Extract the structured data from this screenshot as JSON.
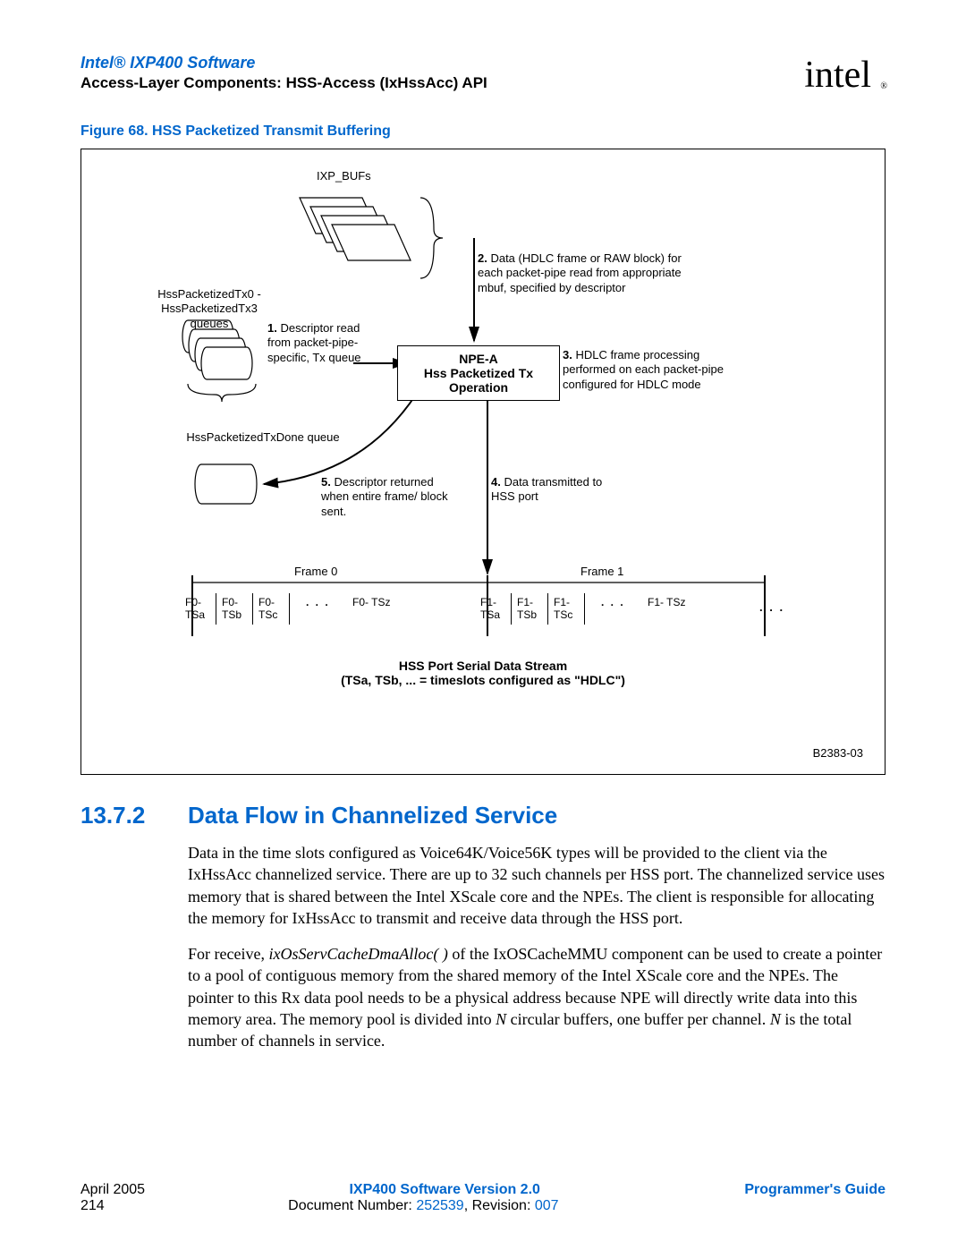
{
  "header": {
    "title": "Intel® IXP400 Software",
    "subtitle": "Access-Layer Components: HSS-Access (IxHssAcc) API",
    "logo_text": "intel",
    "logo_reg": "®"
  },
  "figure": {
    "caption": "Figure 68. HSS Packetized Transmit Buffering",
    "ixpbufs": "IXP_BUFs",
    "queues_label": "HssPacketizedTx0 - HssPacketizedTx3 queues",
    "step1_num": "1.",
    "step1": " Descriptor read from packet-pipe-specific, Tx queue",
    "npe_line1": "NPE-A",
    "npe_line2": "Hss Packetized Tx",
    "npe_line3": "Operation",
    "step2_num": "2.",
    "step2": " Data (HDLC frame or RAW block) for each packet-pipe read from appropriate mbuf, specified by descriptor",
    "step3_num": "3.",
    "step3": " HDLC frame processing performed on each packet-pipe configured for HDLC mode",
    "txdone": "HssPacketizedTxDone queue",
    "step5_num": "5.",
    "step5": " Descriptor returned when entire frame/ block sent.",
    "step4_num": "4.",
    "step4": " Data transmitted to HSS port",
    "frame0": "Frame 0",
    "frame1": "Frame 1",
    "dots": ". . .",
    "ts": {
      "f0a": "F0-\nTSa",
      "f0b": "F0-\nTSb",
      "f0c": "F0-\nTSc",
      "f0z": "F0-\nTSz",
      "f1a": "F1-\nTSa",
      "f1b": "F1-\nTSb",
      "f1c": "F1-\nTSc",
      "f1z": "F1-\nTSz"
    },
    "stream1": "HSS Port Serial Data Stream",
    "stream2": "(TSa, TSb, ... = timeslots configured as \"HDLC\")",
    "figid": "B2383-03"
  },
  "section": {
    "num": "13.7.2",
    "title": "Data Flow in Channelized Service"
  },
  "para1_a": "Data in the time slots configured as Voice64K/Voice56K types will be provided to the client via the IxHssAcc channelized service. There are up to 32 such channels per HSS port. The channelized service uses memory that is shared between the Intel XScale core and the NPEs. The client is responsible for allocating the memory for IxHssAcc to transmit and receive data through the HSS port.",
  "para2_a": "For receive, ",
  "para2_i": "ixOsServCacheDmaAlloc( )",
  "para2_b": " of the IxOSCacheMMU component can be used to create a pointer to a pool of contiguous memory from the shared memory of the Intel XScale core and the NPEs. The pointer to this Rx data pool needs to be a physical address because NPE will directly write data into this memory area. The memory pool is divided into ",
  "para2_n1": "N",
  "para2_c": " circular buffers, one buffer per channel. ",
  "para2_n2": "N",
  "para2_d": " is the total number of channels in service.",
  "footer": {
    "date": "April 2005",
    "version": "IXP400 Software Version 2.0",
    "guide": "Programmer's Guide",
    "page": "214",
    "docnum_label": "Document Number: ",
    "docnum": "252539",
    "rev_label": ", Revision: ",
    "rev": "007"
  }
}
